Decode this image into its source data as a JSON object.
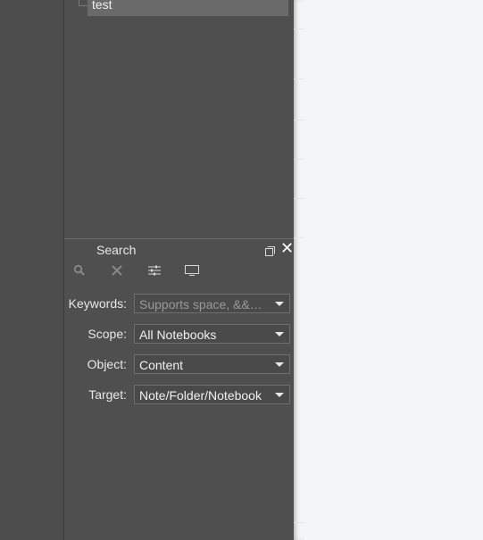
{
  "tree": {
    "item_label": "test"
  },
  "search_dock": {
    "title": "Search",
    "toolbar": [
      {
        "name": "search-icon"
      },
      {
        "name": "clear-icon"
      },
      {
        "name": "advanced-settings-icon"
      },
      {
        "name": "console-icon"
      }
    ],
    "fields": {
      "keywords": {
        "label": "Keywords:",
        "placeholder": "Supports space, &&…"
      },
      "scope": {
        "label": "Scope:",
        "value": "All Notebooks"
      },
      "object": {
        "label": "Object:",
        "value": "Content"
      },
      "target": {
        "label": "Target:",
        "value": "Note/Folder/Notebook"
      }
    }
  },
  "colors": {
    "panel": "#4f4f4f",
    "sidebar": "#4d4d4d",
    "editor_background": "#f4f5f7",
    "text": "#e8e8e8"
  }
}
